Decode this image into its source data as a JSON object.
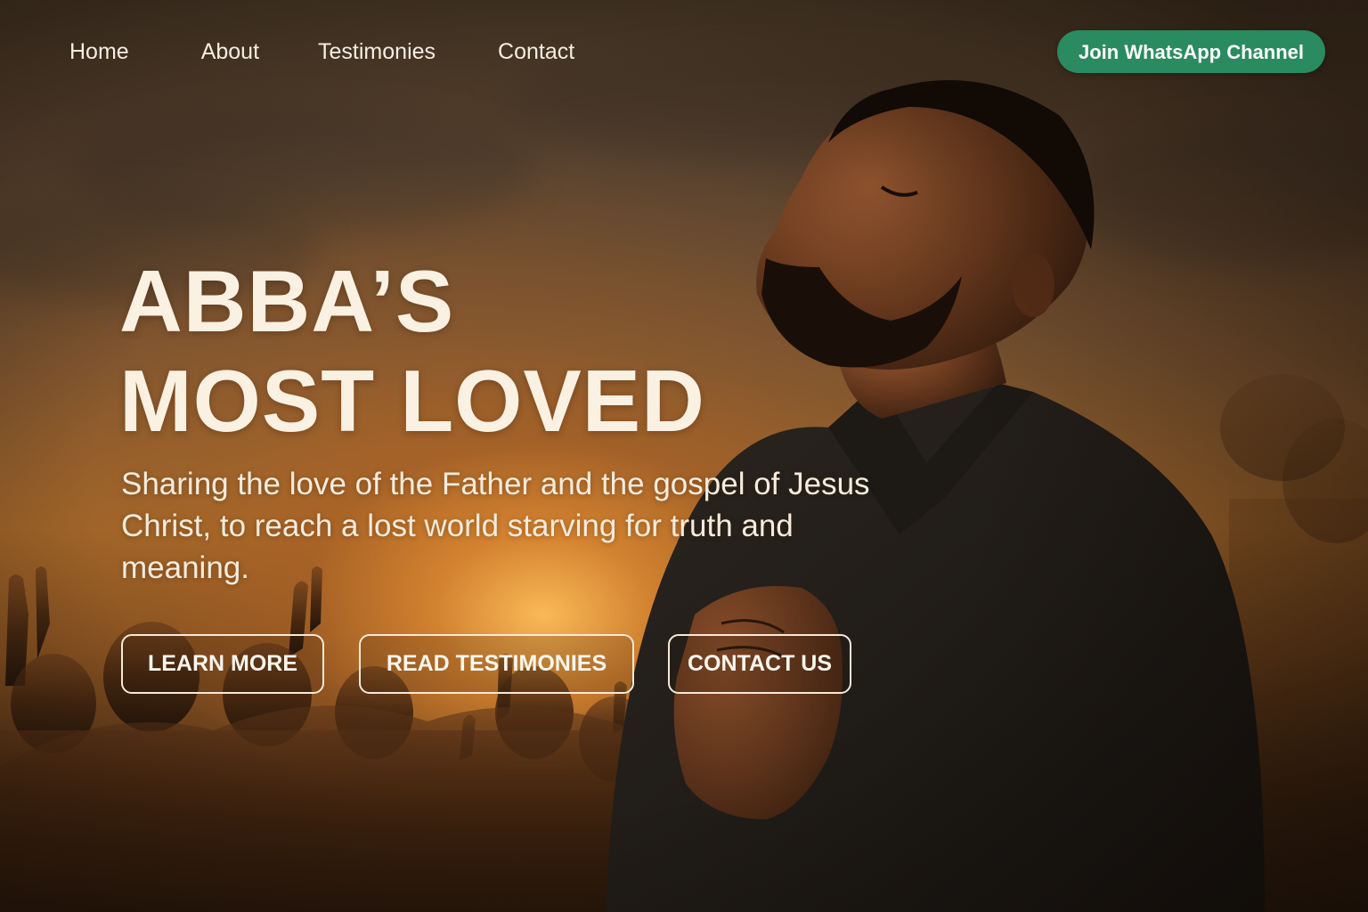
{
  "nav": {
    "items": [
      {
        "label": "Home"
      },
      {
        "label": "About"
      },
      {
        "label": "Testimonies"
      },
      {
        "label": "Contact"
      }
    ],
    "cta_label": "Join WhatsApp Channel",
    "cta_color": "#2a8a60"
  },
  "hero": {
    "title_line1": "ABBA’S",
    "title_line2": "MOST LOVED",
    "subtitle": "Sharing the love of the Father and the gospel of Jesus Christ, to reach a lost world starving for truth and meaning.",
    "buttons": {
      "learn_more": "LEARN MORE",
      "read_testimonies": "READ TESTIMONIES",
      "contact_us": "CONTACT US"
    },
    "background_image": "man-praying-at-sunset-with-worshipping-crowd"
  }
}
